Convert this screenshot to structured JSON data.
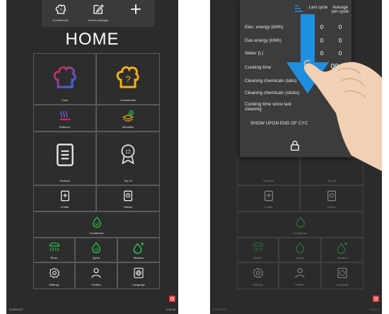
{
  "toolbar": {
    "combiguide_label": "CombiGuide",
    "screen_manager_label": "Screen manager",
    "add_label": ""
  },
  "home": {
    "title": "HOME",
    "tiles": {
      "cook": "Cook",
      "combiguide": "CombiGuide",
      "retherm": "Retherm",
      "menumix": "MenuMix",
      "recipes": "Recipes",
      "top12": "Top 12",
      "top12_number": "12",
      "create": "Create",
      "history": "History",
      "combicare": "CombiCare",
      "rinse": "Rinse",
      "quick": "Quick",
      "medium": "Medium",
      "settings": "Settings",
      "profiles": "Profiles",
      "language": "Language"
    },
    "date": "2025/03/27",
    "time": "9:46:20"
  },
  "overlay": {
    "col_last": "Last cycle",
    "col_avg": "Average per cycle",
    "rows": [
      {
        "label": "Elec. energy (kWh)",
        "last": "0",
        "avg": "0"
      },
      {
        "label": "Gas energy (kWh)",
        "last": "0",
        "avg": "0"
      },
      {
        "label": "Water (L)",
        "last": "0",
        "avg": "0"
      },
      {
        "label": "Cooking time",
        "last": "",
        "avg": "00:00"
      },
      {
        "label": "Cleaning chemicals (tabs)",
        "last": "",
        "avg": ""
      },
      {
        "label": "Cleaning chemicals (sticks)",
        "last": "",
        "avg": ""
      },
      {
        "label": "Cooking time since last cleaning",
        "last": "",
        "avg": ""
      }
    ],
    "show_upon_end": "SHOW UPON END OF CYC"
  },
  "colors": {
    "screen_bg": "#2b2b2b",
    "accent_green": "#26c24a",
    "arrow_blue": "#1e8fe0",
    "cook_red": "#e0203a",
    "cook_blue": "#2a6cff",
    "guide_yellow": "#f2b21c"
  }
}
